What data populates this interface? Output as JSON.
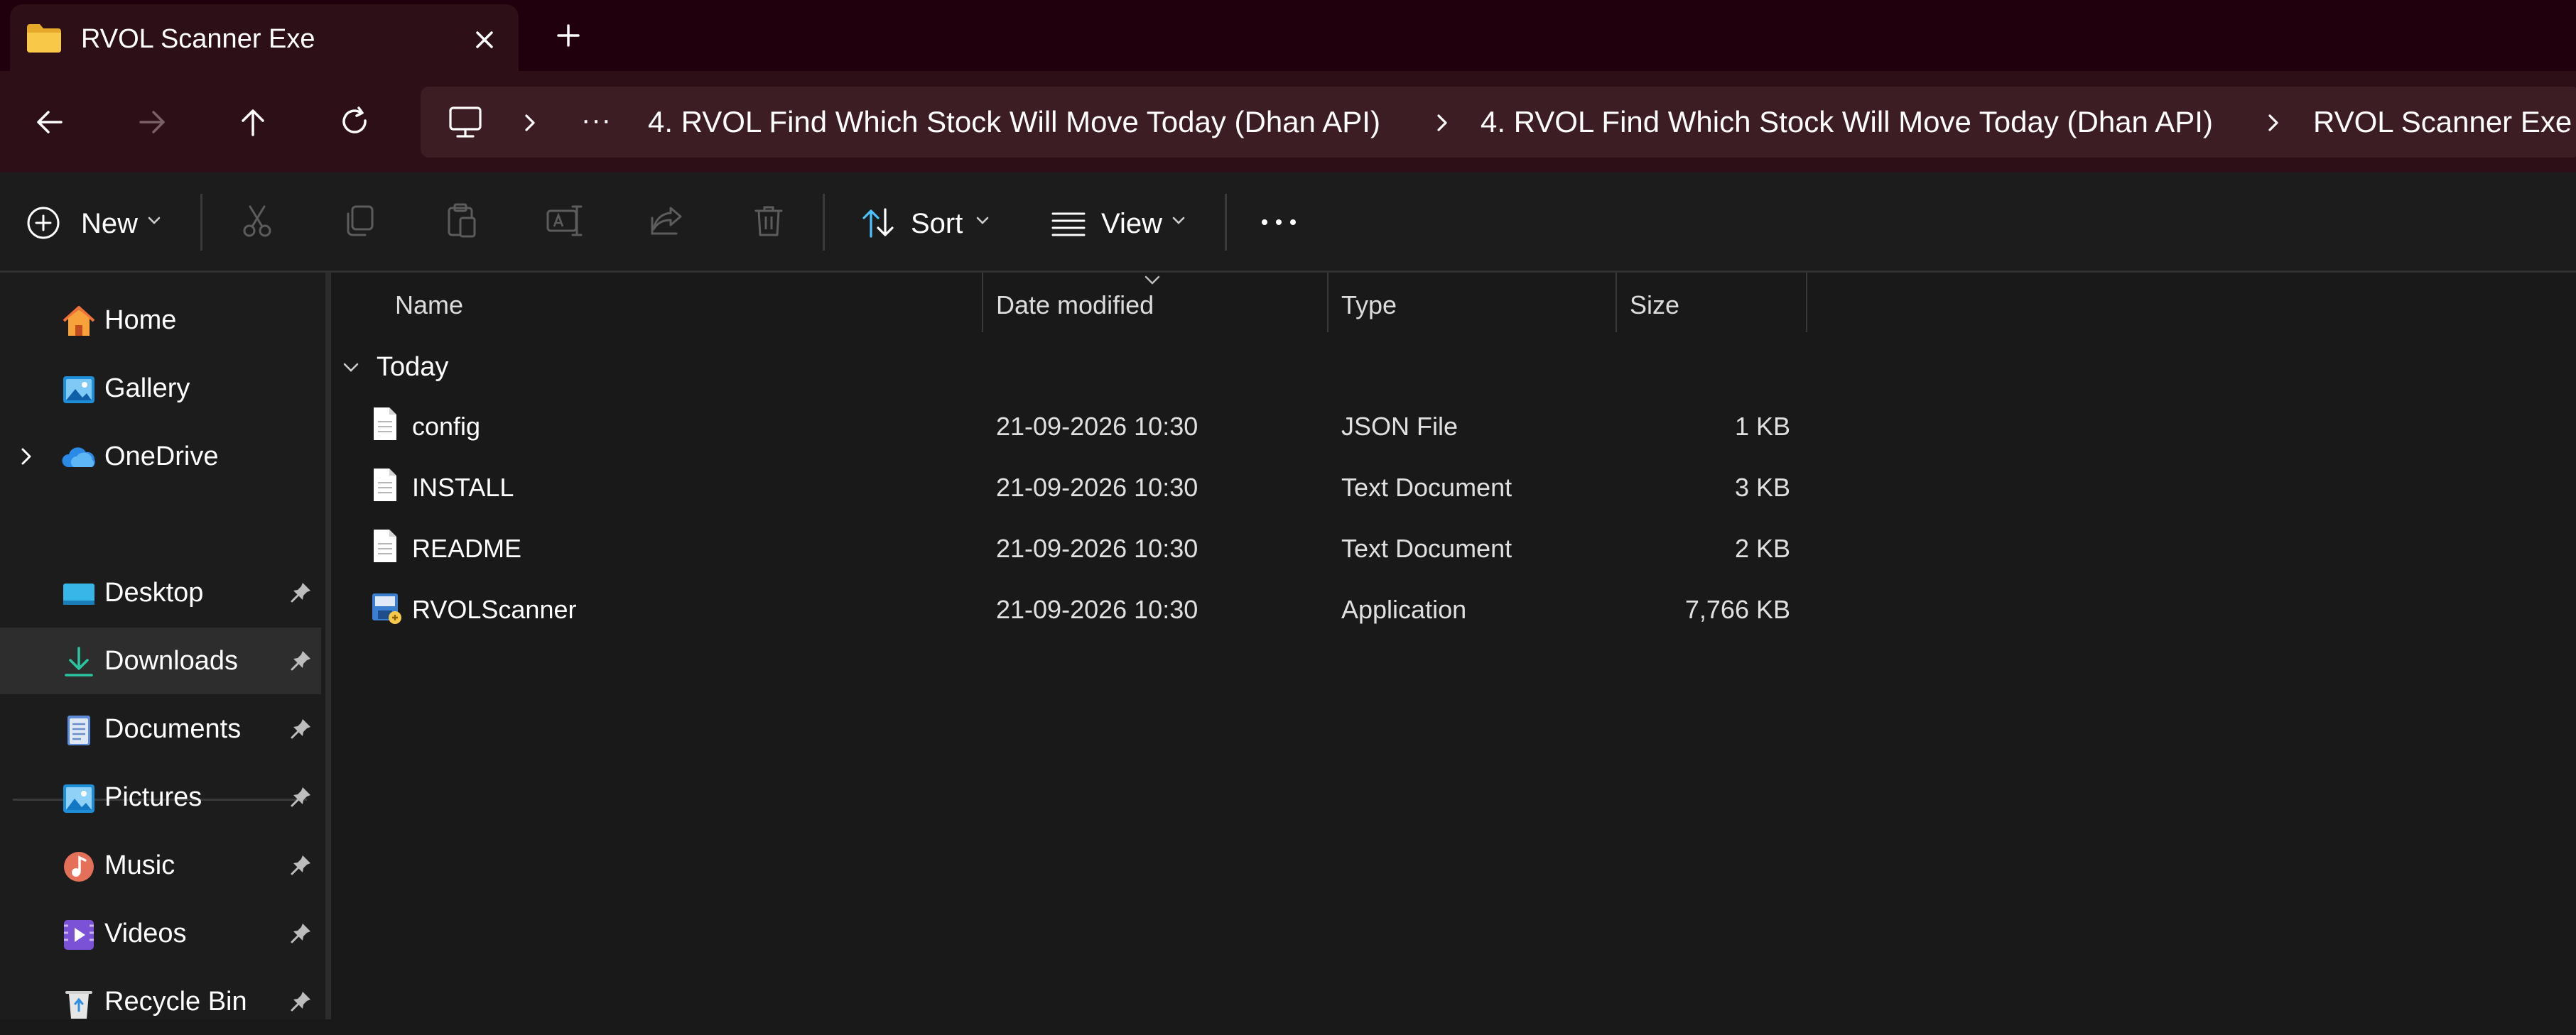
{
  "tab": {
    "title": "RVOL Scanner Exe"
  },
  "breadcrumbs": [
    "4. RVOL Find Which Stock Will Move Today (Dhan API)",
    "4. RVOL Find Which Stock Will Move Today (Dhan API)",
    "RVOL Scanner Exe"
  ],
  "toolbar": {
    "new_label": "New",
    "sort_label": "Sort",
    "view_label": "View"
  },
  "sidebar": {
    "items": [
      {
        "label": "Home",
        "icon": "home-icon"
      },
      {
        "label": "Gallery",
        "icon": "gallery-icon"
      },
      {
        "label": "OneDrive",
        "icon": "onedrive-icon"
      }
    ],
    "pinned": [
      {
        "label": "Desktop",
        "icon": "desktop-folder-icon"
      },
      {
        "label": "Downloads",
        "icon": "downloads-icon",
        "selected": true
      },
      {
        "label": "Documents",
        "icon": "documents-icon"
      },
      {
        "label": "Pictures",
        "icon": "pictures-icon"
      },
      {
        "label": "Music",
        "icon": "music-icon"
      },
      {
        "label": "Videos",
        "icon": "videos-icon"
      },
      {
        "label": "Recycle Bin",
        "icon": "recycle-bin-icon"
      }
    ]
  },
  "columns": {
    "name": "Name",
    "date": "Date modified",
    "type": "Type",
    "size": "Size"
  },
  "group": {
    "label": "Today"
  },
  "files": [
    {
      "name": "config",
      "date": "21-09-2026 10:30",
      "type": "JSON File",
      "size": "1 KB",
      "icon": "file-icon"
    },
    {
      "name": "INSTALL",
      "date": "21-09-2026 10:30",
      "type": "Text Document",
      "size": "3 KB",
      "icon": "file-icon"
    },
    {
      "name": "README",
      "date": "21-09-2026 10:30",
      "type": "Text Document",
      "size": "2 KB",
      "icon": "file-icon"
    },
    {
      "name": "RVOLScanner",
      "date": "21-09-2026 10:30",
      "type": "Application",
      "size": "7,766 KB",
      "icon": "application-icon"
    }
  ],
  "colors": {
    "accent": "#4cc2ff",
    "background": "#191919",
    "titlebar": "#20000c",
    "navbar": "#2d0f17",
    "address": "#3d1d24"
  }
}
